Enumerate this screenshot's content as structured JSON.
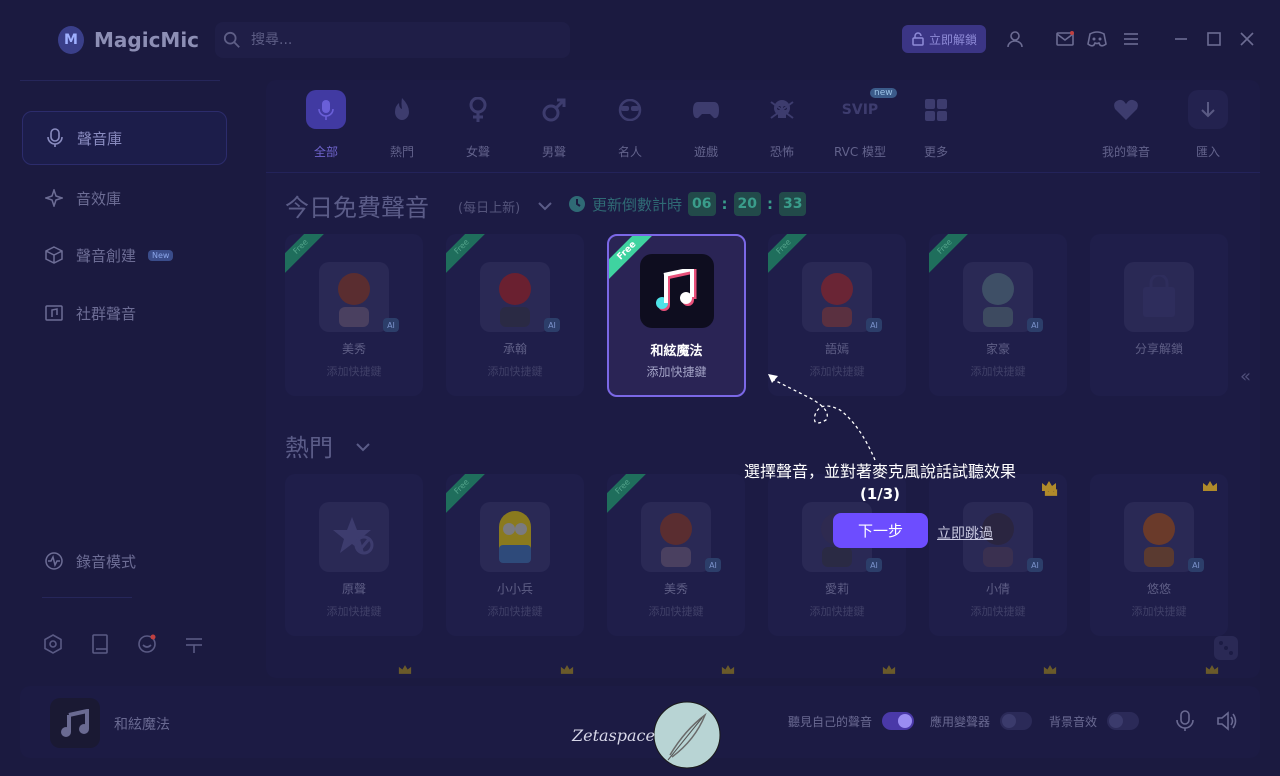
{
  "app": {
    "name": "MagicMic"
  },
  "search": {
    "placeholder": "搜尋..."
  },
  "titlebar": {
    "unlock_label": "立即解鎖"
  },
  "sidebar": {
    "items": [
      {
        "label": "聲音庫",
        "icon": "microphone-icon"
      },
      {
        "label": "音效庫",
        "icon": "sparkle-icon"
      },
      {
        "label": "聲音創建",
        "icon": "cube-icon",
        "badge": "New"
      },
      {
        "label": "社群聲音",
        "icon": "music-folder-icon"
      }
    ],
    "record_mode": "錄音模式"
  },
  "categories": [
    {
      "label": "全部",
      "icon": "microphone-icon"
    },
    {
      "label": "熱門",
      "icon": "fire-icon"
    },
    {
      "label": "女聲",
      "icon": "female-icon"
    },
    {
      "label": "男聲",
      "icon": "male-icon"
    },
    {
      "label": "名人",
      "icon": "sunglasses-icon"
    },
    {
      "label": "遊戲",
      "icon": "gamepad-icon"
    },
    {
      "label": "恐怖",
      "icon": "skull-icon"
    },
    {
      "label": "RVC 模型",
      "icon": "svip-icon",
      "badge": "new",
      "icon_text": "SVIP"
    },
    {
      "label": "更多",
      "icon": "grid-icon"
    },
    {
      "label": "我的聲音",
      "icon": "heart-icon"
    },
    {
      "label": "匯入",
      "icon": "import-icon"
    }
  ],
  "free_section": {
    "title": "今日免費聲音",
    "subtitle": "(每日上新)",
    "countdown_label": "更新倒數計時",
    "countdown": {
      "h": "06",
      "m": "20",
      "s": "33"
    },
    "ribbon": "Free",
    "cards": [
      {
        "name": "美秀",
        "sub": "添加快捷鍵"
      },
      {
        "name": "承翰",
        "sub": "添加快捷鍵"
      },
      {
        "name": "和絃魔法",
        "sub": "添加快捷鍵"
      },
      {
        "name": "語嫣",
        "sub": "添加快捷鍵"
      },
      {
        "name": "家豪",
        "sub": "添加快捷鍵"
      },
      {
        "name": "分享解鎖",
        "sub": ""
      }
    ]
  },
  "hot_section": {
    "title": "熱門",
    "cards": [
      {
        "name": "原聲",
        "sub": "添加快捷鍵"
      },
      {
        "name": "小小兵",
        "sub": "添加快捷鍵"
      },
      {
        "name": "美秀",
        "sub": "添加快捷鍵"
      },
      {
        "name": "愛莉",
        "sub": "添加快捷鍵"
      },
      {
        "name": "小倩",
        "sub": "添加快捷鍵"
      },
      {
        "name": "悠悠",
        "sub": "添加快捷鍵"
      }
    ]
  },
  "tour": {
    "text": "選擇聲音，並對著麥克風說話試聽效果",
    "step": "(1/3)",
    "next_label": "下一步",
    "skip_label": "立即跳過"
  },
  "bottombar": {
    "current_voice": "和絃魔法",
    "hear_self": "聽見自己的聲音",
    "apply_changer": "應用變聲器",
    "bg_effect": "背景音效"
  },
  "watermark": {
    "text": "Zetaspace"
  },
  "colors": {
    "accent": "#6d4dff",
    "highlight_border": "#7b68e6",
    "free_ribbon": "#3fd3a0",
    "background": "#1b1a40"
  }
}
